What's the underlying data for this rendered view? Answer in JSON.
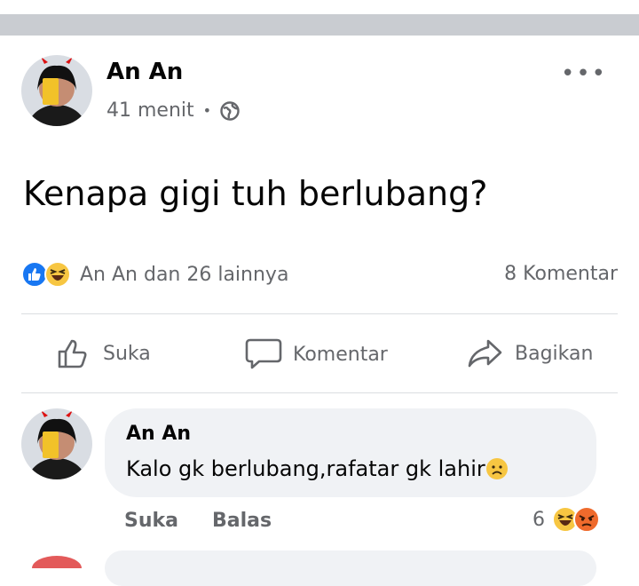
{
  "post": {
    "author": "An An",
    "time": "41 menit",
    "separator": "•",
    "privacy_icon": "globe-icon",
    "text": "Kenapa gigi tuh berlubang?",
    "more_icon": "more-options-icon"
  },
  "reactions": {
    "icons": [
      "like-icon",
      "haha-icon"
    ],
    "summary": "An An dan 26 lainnya",
    "comments": "8 Komentar"
  },
  "actions": {
    "like": "Suka",
    "comment": "Komentar",
    "share": "Bagikan"
  },
  "comment": {
    "author": "An An",
    "text": "Kalo gk berlubang,rafatar gk lahir",
    "emoji": "sad-emoji-icon",
    "like_label": "Suka",
    "reply_label": "Balas",
    "reaction_count": "6",
    "reaction_icons": [
      "haha-icon",
      "angry-icon"
    ]
  },
  "colors": {
    "accent": "#1877f2",
    "secondary_text": "#65676b",
    "bubble": "#f0f2f5",
    "separator": "#c9ccd1"
  }
}
